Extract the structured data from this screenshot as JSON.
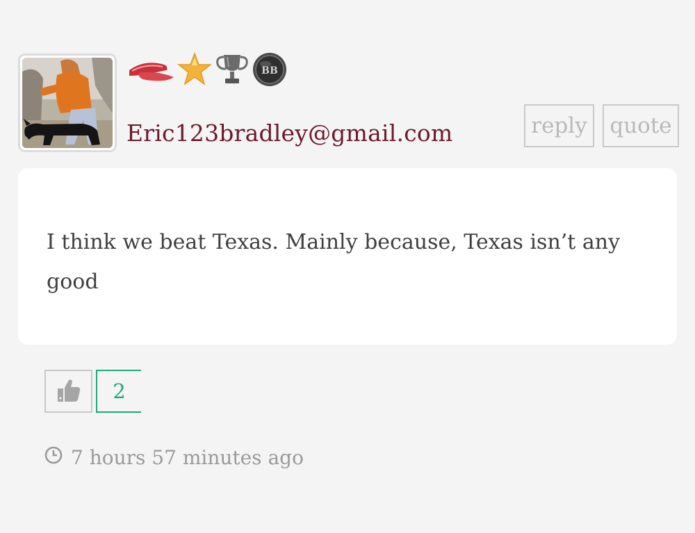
{
  "post": {
    "author": {
      "username": "Eric123bradley@gmail.com",
      "avatar": "photo of a person in an orange jacket with a black dog",
      "badges": [
        "red-visor-icon",
        "gold-star-icon",
        "silver-trophy-icon",
        "black-coin-badge-icon"
      ]
    },
    "actions": {
      "reply_label": "reply",
      "quote_label": "quote"
    },
    "body": "I think we beat Texas. Mainly because, Texas isn’t any good",
    "likes": {
      "icon": "thumbs-up-icon",
      "count": "2"
    },
    "timestamp": "7 hours 57 minutes ago"
  },
  "colors": {
    "background": "#f4f4f4",
    "username": "#6b1a2a",
    "like_accent": "#1fa87b",
    "muted_text": "#9a9a9a"
  }
}
